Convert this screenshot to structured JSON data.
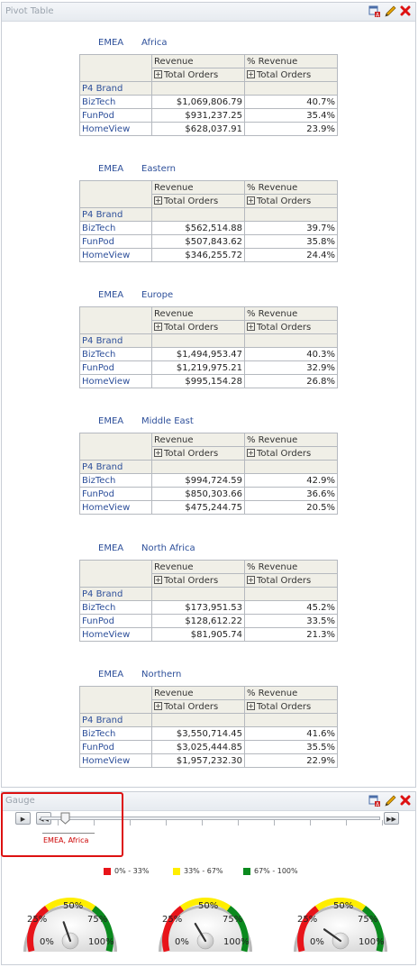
{
  "pivot_panel": {
    "title": "Pivot Table"
  },
  "table_headers": {
    "col1": "Revenue",
    "col2": "% Revenue",
    "sub1": "Total Orders",
    "sub2": "Total Orders",
    "row_group": "P4 Brand"
  },
  "sections": [
    {
      "region": "EMEA",
      "city": "Africa",
      "rows": [
        {
          "brand": "BizTech",
          "revenue": "$1,069,806.79",
          "pct": "40.7%"
        },
        {
          "brand": "FunPod",
          "revenue": "$931,237.25",
          "pct": "35.4%"
        },
        {
          "brand": "HomeView",
          "revenue": "$628,037.91",
          "pct": "23.9%"
        }
      ]
    },
    {
      "region": "EMEA",
      "city": "Eastern",
      "rows": [
        {
          "brand": "BizTech",
          "revenue": "$562,514.88",
          "pct": "39.7%"
        },
        {
          "brand": "FunPod",
          "revenue": "$507,843.62",
          "pct": "35.8%"
        },
        {
          "brand": "HomeView",
          "revenue": "$346,255.72",
          "pct": "24.4%"
        }
      ]
    },
    {
      "region": "EMEA",
      "city": "Europe",
      "rows": [
        {
          "brand": "BizTech",
          "revenue": "$1,494,953.47",
          "pct": "40.3%"
        },
        {
          "brand": "FunPod",
          "revenue": "$1,219,975.21",
          "pct": "32.9%"
        },
        {
          "brand": "HomeView",
          "revenue": "$995,154.28",
          "pct": "26.8%"
        }
      ]
    },
    {
      "region": "EMEA",
      "city": "Middle East",
      "rows": [
        {
          "brand": "BizTech",
          "revenue": "$994,724.59",
          "pct": "42.9%"
        },
        {
          "brand": "FunPod",
          "revenue": "$850,303.66",
          "pct": "36.6%"
        },
        {
          "brand": "HomeView",
          "revenue": "$475,244.75",
          "pct": "20.5%"
        }
      ]
    },
    {
      "region": "EMEA",
      "city": "North Africa",
      "rows": [
        {
          "brand": "BizTech",
          "revenue": "$173,951.53",
          "pct": "45.2%"
        },
        {
          "brand": "FunPod",
          "revenue": "$128,612.22",
          "pct": "33.5%"
        },
        {
          "brand": "HomeView",
          "revenue": "$81,905.74",
          "pct": "21.3%"
        }
      ]
    },
    {
      "region": "EMEA",
      "city": "Northern",
      "rows": [
        {
          "brand": "BizTech",
          "revenue": "$3,550,714.45",
          "pct": "41.6%"
        },
        {
          "brand": "FunPod",
          "revenue": "$3,025,444.85",
          "pct": "35.5%"
        },
        {
          "brand": "HomeView",
          "revenue": "$1,957,232.30",
          "pct": "22.9%"
        }
      ]
    }
  ],
  "gauge_panel": {
    "title": "Gauge"
  },
  "slider": {
    "current_label": "EMEA, Africa",
    "play_glyph": "▶",
    "prev_glyph": "◀◀",
    "next_glyph": "▶▶",
    "tick_count": 10
  },
  "legend": [
    {
      "label": "0% - 33%",
      "color": "#e8141a"
    },
    {
      "label": "33% - 67%",
      "color": "#ffee00"
    },
    {
      "label": "67% - 100%",
      "color": "#0a8a1e"
    }
  ],
  "gauges": [
    {
      "value_pct": 40.7,
      "labels": [
        "0%",
        "25%",
        "50%",
        "75%",
        "100%"
      ]
    },
    {
      "value_pct": 35.4,
      "labels": [
        "0%",
        "25%",
        "50%",
        "75%",
        "100%"
      ]
    },
    {
      "value_pct": 23.9,
      "labels": [
        "0%",
        "25%",
        "50%",
        "75%",
        "100%"
      ]
    }
  ],
  "colors": {
    "link": "#2d4f9a",
    "header_bg": "#f0efe7",
    "highlight": "#dd1111"
  },
  "icons": {
    "edit_props": "edit-properties-icon",
    "pencil": "pencil-icon",
    "close": "close-icon"
  }
}
